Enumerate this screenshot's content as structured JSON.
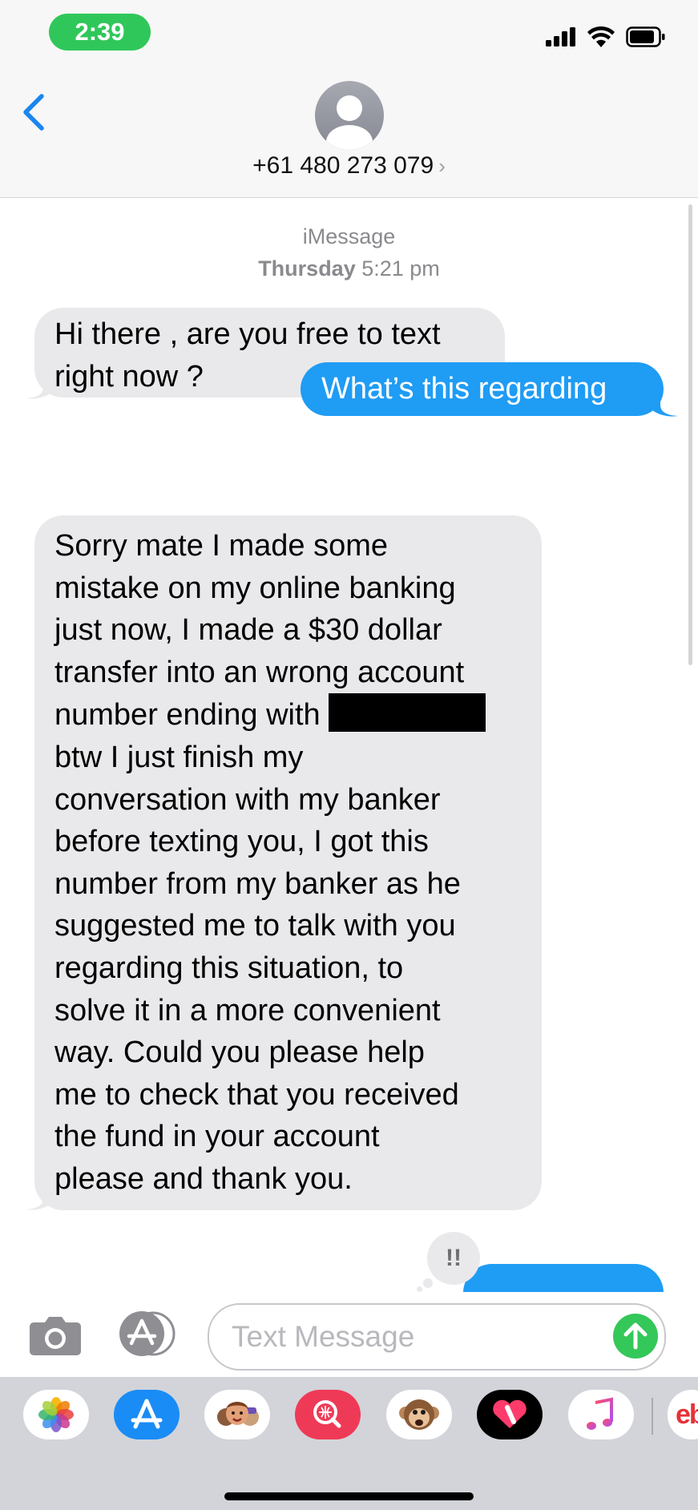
{
  "status_bar": {
    "time": "2:39",
    "icons": [
      "cellular-signal-icon",
      "wifi-icon",
      "battery-icon"
    ],
    "pill_color": "#30c75a"
  },
  "header": {
    "back_icon": "chevron-left-icon",
    "contact_number": "+61 480 273 079",
    "contact_chevron": "›"
  },
  "conversation": {
    "service": "iMessage",
    "timestamp_day": "Thursday",
    "timestamp_time": "5:21 pm",
    "messages": [
      {
        "direction": "incoming",
        "lines": [
          "Hi there , are you free to text",
          "right now ?"
        ]
      },
      {
        "direction": "outgoing",
        "lines": [
          "What’s this regarding"
        ]
      },
      {
        "direction": "incoming",
        "lines": [
          "Sorry mate I made some",
          "mistake on my online banking",
          "just now, I made a $30 dollar",
          "transfer into an wrong account",
          "number ending with",
          "btw I just finish my",
          "conversation with my banker",
          "before texting you, I got this",
          "number from my banker as he",
          "suggested me to talk with you",
          "regarding this situation, to",
          "solve it in a more convenient",
          "way. Could you please help",
          "me to check that you received",
          "the fund in your account",
          "please and thank you."
        ]
      }
    ],
    "reaction": "!!",
    "bubble_colors": {
      "incoming": "#e9e9eb",
      "outgoing": "#1f9cf4"
    }
  },
  "input": {
    "placeholder": "Text Message",
    "value": "",
    "send_color": "#34c759"
  },
  "app_drawer": {
    "apps": [
      "photos-app-icon",
      "app-store-icon",
      "memoji-stickers-icon",
      "web-images-search-icon",
      "animoji-icon",
      "digital-touch-icon",
      "music-app-icon",
      "ebay-app-icon"
    ],
    "ebay_label": "eb"
  }
}
